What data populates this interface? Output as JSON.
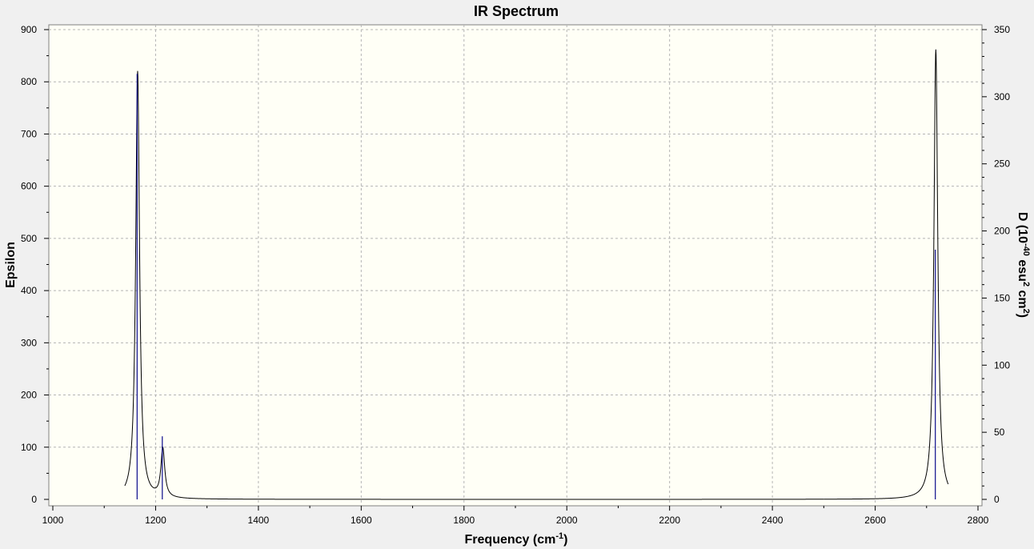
{
  "chart_data": {
    "type": "line",
    "title": "IR Spectrum",
    "xlabel": "Frequency (cm",
    "xlabel_sup": "-1",
    "xlabel_end": ")",
    "ylabel": "Epsilon",
    "y2label": {
      "p1": "D (10",
      "s1": "-40",
      "p2": " esu",
      "s2": "2",
      "p3": " cm",
      "s3": "2",
      "p4": ")"
    },
    "xlim": [
      1000,
      2800
    ],
    "ylim": [
      0,
      900
    ],
    "y2lim": [
      0,
      350
    ],
    "x_ticks": [
      "1000",
      "1200",
      "1400",
      "1600",
      "1800",
      "2000",
      "2200",
      "2400",
      "2600",
      "2800"
    ],
    "y_ticks": [
      "0",
      "100",
      "200",
      "300",
      "400",
      "500",
      "600",
      "700",
      "800",
      "900"
    ],
    "y2_ticks": [
      "0",
      "50",
      "100",
      "150",
      "200",
      "250",
      "300",
      "350"
    ],
    "grid": true,
    "colors": {
      "background": "#fffff6",
      "spectrum": "#000000",
      "sticks": "#0a0a8c"
    },
    "peaks": [
      {
        "x": 1165,
        "epsilon": 820
      },
      {
        "x": 1214,
        "epsilon": 93
      },
      {
        "x": 2718,
        "epsilon": 862
      }
    ],
    "stick_series": [
      {
        "x": 1164,
        "d": 317
      },
      {
        "x": 1213,
        "d": 47
      },
      {
        "x": 2717,
        "d": 186
      }
    ]
  }
}
